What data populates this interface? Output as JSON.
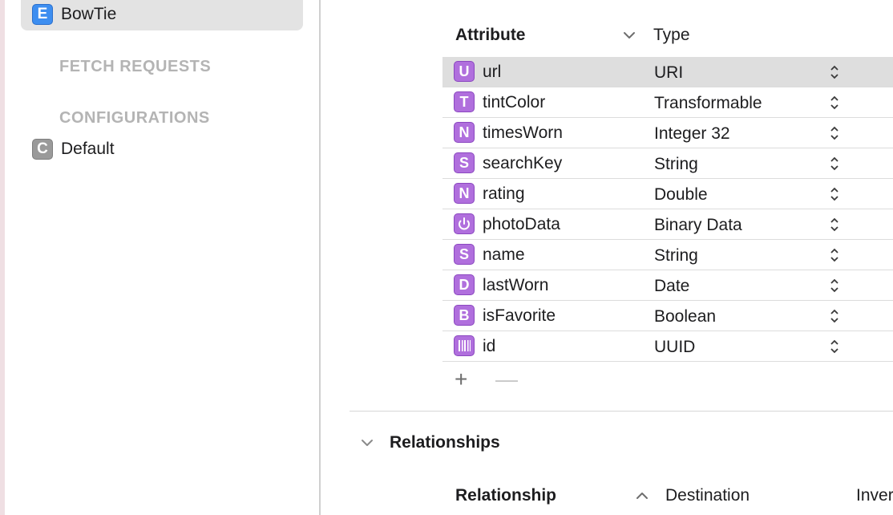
{
  "sidebar": {
    "entity": {
      "badge": "E",
      "label": "BowTie"
    },
    "fetch_requests_header": "FETCH REQUESTS",
    "configurations_header": "CONFIGURATIONS",
    "configuration": {
      "badge": "C",
      "label": "Default"
    }
  },
  "attributes": {
    "col_attribute": "Attribute",
    "col_type": "Type",
    "rows": [
      {
        "badge": "U",
        "name": "url",
        "type": "URI",
        "selected": true
      },
      {
        "badge": "T",
        "name": "tintColor",
        "type": "Transformable"
      },
      {
        "badge": "N",
        "name": "timesWorn",
        "type": "Integer 32"
      },
      {
        "badge": "S",
        "name": "searchKey",
        "type": "String"
      },
      {
        "badge": "N",
        "name": "rating",
        "type": "Double"
      },
      {
        "badge": "power-icon",
        "name": "photoData",
        "type": "Binary Data"
      },
      {
        "badge": "S",
        "name": "name",
        "type": "String"
      },
      {
        "badge": "D",
        "name": "lastWorn",
        "type": "Date"
      },
      {
        "badge": "B",
        "name": "isFavorite",
        "type": "Boolean"
      },
      {
        "badge": "barcode-icon",
        "name": "id",
        "type": "UUID"
      }
    ],
    "add_label": "+",
    "remove_label": "—"
  },
  "relationships": {
    "title": "Relationships",
    "col_relationship": "Relationship",
    "col_destination": "Destination",
    "col_inverse": "Inver"
  },
  "colors": {
    "attribute_badge": "#b06fdd",
    "entity_badge": "#3d8ef0",
    "configuration_badge": "#9a9a9a",
    "selected_row": "#dedede"
  }
}
